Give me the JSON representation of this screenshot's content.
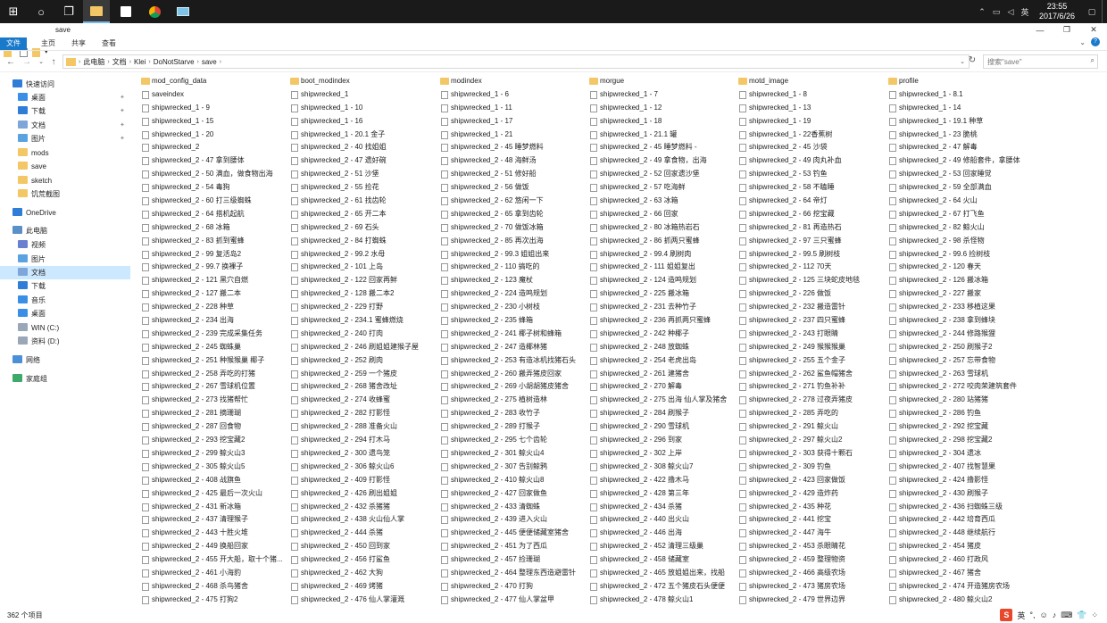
{
  "taskbar": {
    "clock_time": "23:55",
    "clock_date": "2017/6/26",
    "ime": "英"
  },
  "window": {
    "title": "save"
  },
  "ribbon": {
    "tabs": [
      "文件",
      "主页",
      "共享",
      "查看"
    ]
  },
  "address": {
    "crumbs": [
      "此电脑",
      "文档",
      "Klei",
      "DoNotStarve",
      "save"
    ],
    "search_placeholder": "搜索\"save\""
  },
  "nav": [
    {
      "label": "快速访问",
      "icon": "star"
    },
    {
      "label": "桌面",
      "icon": "desktop",
      "pin": true
    },
    {
      "label": "下载",
      "icon": "download",
      "pin": true
    },
    {
      "label": "文档",
      "icon": "document",
      "pin": true
    },
    {
      "label": "图片",
      "icon": "picture",
      "pin": true
    },
    {
      "label": "mods",
      "icon": "folder"
    },
    {
      "label": "save",
      "icon": "folder"
    },
    {
      "label": "sketch",
      "icon": "folder"
    },
    {
      "label": "饥荒截图",
      "icon": "folder"
    },
    {
      "label": "OneDrive",
      "icon": "cloud"
    },
    {
      "label": "此电脑",
      "icon": "computer"
    },
    {
      "label": "视频",
      "icon": "video"
    },
    {
      "label": "图片",
      "icon": "picture"
    },
    {
      "label": "文档",
      "icon": "document",
      "selected": true
    },
    {
      "label": "下载",
      "icon": "download"
    },
    {
      "label": "音乐",
      "icon": "music"
    },
    {
      "label": "桌面",
      "icon": "desktop"
    },
    {
      "label": "WIN (C:)",
      "icon": "drive"
    },
    {
      "label": "资料 (D:)",
      "icon": "drive"
    },
    {
      "label": "网络",
      "icon": "network"
    },
    {
      "label": "家庭组",
      "icon": "homegroup"
    }
  ],
  "files": [
    [
      "mod_config_data",
      "boot_modindex",
      "modindex",
      "morgue",
      "motd_image",
      "profile"
    ],
    [
      "saveindex",
      "shipwrecked_1",
      "shipwrecked_1 - 6",
      "shipwrecked_1 - 7",
      "shipwrecked_1 - 8",
      "shipwrecked_1 - 8.1"
    ],
    [
      "shipwrecked_1 - 9",
      "shipwrecked_1 - 10",
      "shipwrecked_1 - 11",
      "shipwrecked_1 - 12",
      "shipwrecked_1 - 13",
      "shipwrecked_1 - 14"
    ],
    [
      "shipwrecked_1 - 15",
      "shipwrecked_1 - 16",
      "shipwrecked_1 - 17",
      "shipwrecked_1 - 18",
      "shipwrecked_1 - 19",
      "shipwrecked_1 - 19.1 种草"
    ],
    [
      "shipwrecked_1 - 20",
      "shipwrecked_1 - 20.1 金子",
      "shipwrecked_1 - 21",
      "shipwrecked_1 - 21.1 罐",
      "shipwrecked_1 - 22香蕉树",
      "shipwrecked_1 - 23 脆桃"
    ],
    [
      "shipwrecked_2",
      "shipwrecked_2 - 40 找姐姐",
      "shipwrecked_2 - 45 睡梦燃料",
      "shipwrecked_2 - 45 睡梦燃料 -",
      "shipwrecked_2 - 45 沙袋",
      "shipwrecked_2 - 47 解毒"
    ],
    [
      "shipwrecked_2 - 47 拿到腰体",
      "shipwrecked_2 - 47 遗好碗",
      "shipwrecked_2 - 48 海鲜汤",
      "shipwrecked_2 - 49 拿食物，出海",
      "shipwrecked_2 - 49 肉丸补血",
      "shipwrecked_2 - 49 修船套件，拿腰体"
    ],
    [
      "shipwrecked_2 - 50 满血，做食物出海",
      "shipwrecked_2 - 51 沙堡",
      "shipwrecked_2 - 51 修好船",
      "shipwrecked_2 - 52 回家遗沙堡",
      "shipwrecked_2 - 53 钓鱼",
      "shipwrecked_2 - 53 回家睡觉"
    ],
    [
      "shipwrecked_2 - 54 毒狗",
      "shipwrecked_2 - 55 捡花",
      "shipwrecked_2 - 56 做饭",
      "shipwrecked_2 - 57 吃海鲜",
      "shipwrecked_2 - 58 不瞌睡",
      "shipwrecked_2 - 59 全部满血"
    ],
    [
      "shipwrecked_2 - 60 打三级蜘蛛",
      "shipwrecked_2 - 61 找齿轮",
      "shipwrecked_2 - 62 悠闲一下",
      "shipwrecked_2 - 63 冰箱",
      "shipwrecked_2 - 64 帝灯",
      "shipwrecked_2 - 64 火山"
    ],
    [
      "shipwrecked_2 - 64 搭机起航",
      "shipwrecked_2 - 65 开二本",
      "shipwrecked_2 - 65 拿到齿轮",
      "shipwrecked_2 - 66 回家",
      "shipwrecked_2 - 66 挖宝藏",
      "shipwrecked_2 - 67 打飞鱼"
    ],
    [
      "shipwrecked_2 - 68 冰箱",
      "shipwrecked_2 - 69 石头",
      "shipwrecked_2 - 70 做饭冰箱",
      "shipwrecked_2 - 80 冰箱热岩石",
      "shipwrecked_2 - 81 再造热石",
      "shipwrecked_2 - 82 鲸火山"
    ],
    [
      "shipwrecked_2 - 83 抓到蜜蜂",
      "shipwrecked_2 - 84 打蜘蛛",
      "shipwrecked_2 - 85 再次出海",
      "shipwrecked_2 - 86 抓两只蜜蜂",
      "shipwrecked_2 - 97 三只蜜蜂",
      "shipwrecked_2 - 98 杀怪物"
    ],
    [
      "shipwrecked_2 - 99 复活岛2",
      "shipwrecked_2 - 99.2 水母",
      "shipwrecked_2 - 99.3 姐姐出来",
      "shipwrecked_2 - 99.4 刷树肉",
      "shipwrecked_2 - 99.5 刷树枝",
      "shipwrecked_2 - 99.6 捡树枝"
    ],
    [
      "shipwrecked_2 - 99.7 换裸子",
      "shipwrecked_2 - 101 上岛",
      "shipwrecked_2 - 110 搞吃的",
      "shipwrecked_2 - 111 姐姐复出",
      "shipwrecked_2 - 112 70天",
      "shipwrecked_2 - 120 春天"
    ],
    [
      "shipwrecked_2 - 121 黑穴自燃",
      "shipwrecked_2 - 122 回家再鲜",
      "shipwrecked_2 - 123 魔杖",
      "shipwrecked_2 - 124 造鸣规划",
      "shipwrecked_2 - 125 三块蛇皮地毯",
      "shipwrecked_2 - 126 搬冰箱"
    ],
    [
      "shipwrecked_2 - 127 搬二本",
      "shipwrecked_2 - 128 搬二本2",
      "shipwrecked_2 - 224 造鸣规划",
      "shipwrecked_2 - 225 搬冰箱",
      "shipwrecked_2 - 226 做饭",
      "shipwrecked_2 - 227 搬家"
    ],
    [
      "shipwrecked_2 - 228 种草",
      "shipwrecked_2 - 229 打野",
      "shipwrecked_2 - 230 小树枝",
      "shipwrecked_2 - 231 去种竹子",
      "shipwrecked_2 - 232 搬造雷针",
      "shipwrecked_2 - 233 移植这果"
    ],
    [
      "shipwrecked_2 - 234 出海",
      "shipwrecked_2 - 234.1 蜜蜂燃烧",
      "shipwrecked_2 - 235 蜂箱",
      "shipwrecked_2 - 236 再抓两只蜜蜂",
      "shipwrecked_2 - 237 四只蜜蜂",
      "shipwrecked_2 - 238 拿到蜂块"
    ],
    [
      "shipwrecked_2 - 239 完成采集任务",
      "shipwrecked_2 - 240 打肉",
      "shipwrecked_2 - 241 椰子树和蜂箱",
      "shipwrecked_2 - 242 种椰子",
      "shipwrecked_2 - 243 打眼睛",
      "shipwrecked_2 - 244 修路猴狸"
    ],
    [
      "shipwrecked_2 - 245 蜘蛛巢",
      "shipwrecked_2 - 246 刷姐姐建猴子屋",
      "shipwrecked_2 - 247 造椰林猪",
      "shipwrecked_2 - 248 放蜘蛛",
      "shipwrecked_2 - 249 猴猴猴巢",
      "shipwrecked_2 - 250 刷猴子2"
    ],
    [
      "shipwrecked_2 - 251 种猴猴巢 椰子",
      "shipwrecked_2 - 252 刷肉",
      "shipwrecked_2 - 253 有造冰机找猪石头",
      "shipwrecked_2 - 254 老虎出岛",
      "shipwrecked_2 - 255 五个金子",
      "shipwrecked_2 - 257 忘带食物"
    ],
    [
      "shipwrecked_2 - 258 弄吃的打猪",
      "shipwrecked_2 - 259 一个猪皮",
      "shipwrecked_2 - 260 搬弄猪皮回家",
      "shipwrecked_2 - 261 建猪舍",
      "shipwrecked_2 - 262 鲨鱼帽猪舍",
      "shipwrecked_2 - 263 雪球机"
    ],
    [
      "shipwrecked_2 - 267 雪球机位置",
      "shipwrecked_2 - 268 猪舍改址",
      "shipwrecked_2 - 269 小胡胡猪皮猪舍",
      "shipwrecked_2 - 270 解毒",
      "shipwrecked_2 - 271 钓鱼补补",
      "shipwrecked_2 - 272 咬肉荣建筑套件"
    ],
    [
      "shipwrecked_2 - 273 找猪帮忙",
      "shipwrecked_2 - 274 收蜂蜜",
      "shipwrecked_2 - 275 植树造林",
      "shipwrecked_2 - 275 出海 仙人掌及猪舍",
      "shipwrecked_2 - 278 过夜弄猪皮",
      "shipwrecked_2 - 280 站猪猪"
    ],
    [
      "shipwrecked_2 - 281 摘珊瑚",
      "shipwrecked_2 - 282 打影怪",
      "shipwrecked_2 - 283 收竹子",
      "shipwrecked_2 - 284 刷猴子",
      "shipwrecked_2 - 285 弄吃的",
      "shipwrecked_2 - 286 钓鱼"
    ],
    [
      "shipwrecked_2 - 287 回食物",
      "shipwrecked_2 - 288 准备火山",
      "shipwrecked_2 - 289 打猴子",
      "shipwrecked_2 - 290 雪球机",
      "shipwrecked_2 - 291 鲸火山",
      "shipwrecked_2 - 292 挖宝藏"
    ],
    [
      "shipwrecked_2 - 293 挖宝藏2",
      "shipwrecked_2 - 294 打木马",
      "shipwrecked_2 - 295 七个齿轮",
      "shipwrecked_2 - 296 到家",
      "shipwrecked_2 - 297 鲸火山2",
      "shipwrecked_2 - 298 挖宝藏2"
    ],
    [
      "shipwrecked_2 - 299 鲸火山3",
      "shipwrecked_2 - 300 遗鸟笼",
      "shipwrecked_2 - 301 鲸火山4",
      "shipwrecked_2 - 302 上岸",
      "shipwrecked_2 - 303 获得十颗石",
      "shipwrecked_2 - 304 遗冰"
    ],
    [
      "shipwrecked_2 - 305 鲸火山5",
      "shipwrecked_2 - 306 鲸火山6",
      "shipwrecked_2 - 307 告别鲸鸦",
      "shipwrecked_2 - 308 鲸火山7",
      "shipwrecked_2 - 309 钓鱼",
      "shipwrecked_2 - 407 找智慧果"
    ],
    [
      "shipwrecked_2 - 408 战旗鱼",
      "shipwrecked_2 - 409 打影怪",
      "shipwrecked_2 - 410 鲸火山8",
      "shipwrecked_2 - 422 撸木马",
      "shipwrecked_2 - 423 回家做饭",
      "shipwrecked_2 - 424 撸影怪"
    ],
    [
      "shipwrecked_2 - 425 最后一次火山",
      "shipwrecked_2 - 426 刷出姐姐",
      "shipwrecked_2 - 427 回家做鱼",
      "shipwrecked_2 - 428 第三年",
      "shipwrecked_2 - 429 造炸药",
      "shipwrecked_2 - 430 刷猴子"
    ],
    [
      "shipwrecked_2 - 431 新冰箱",
      "shipwrecked_2 - 432 杀猪猪",
      "shipwrecked_2 - 433 清蜘蛛",
      "shipwrecked_2 - 434 杀猪",
      "shipwrecked_2 - 435 种花",
      "shipwrecked_2 - 436 扫蜘蛛三级"
    ],
    [
      "shipwrecked_2 - 437 清理猴子",
      "shipwrecked_2 - 438 火山仙人掌",
      "shipwrecked_2 - 439 进入火山",
      "shipwrecked_2 - 440 出火山",
      "shipwrecked_2 - 441 挖宝",
      "shipwrecked_2 - 442 培育西瓜"
    ],
    [
      "shipwrecked_2 - 443 十胜火堆",
      "shipwrecked_2 - 444 杀猪",
      "shipwrecked_2 - 445 便便储藏室猪舍",
      "shipwrecked_2 - 446 出海",
      "shipwrecked_2 - 447 海牛",
      "shipwrecked_2 - 448 继续航行"
    ],
    [
      "shipwrecked_2 - 449 换船回家",
      "shipwrecked_2 - 450 回到家",
      "shipwrecked_2 - 451 为了西瓜",
      "shipwrecked_2 - 452 清理三级巢",
      "shipwrecked_2 - 453 杀眼睛花",
      "shipwrecked_2 - 454 猪皮"
    ],
    [
      "shipwrecked_2 - 455 开大船，取十个猪...",
      "shipwrecked_2 - 456 打鲨鱼",
      "shipwrecked_2 - 457 捡珊瑚",
      "shipwrecked_2 - 458 储藏室",
      "shipwrecked_2 - 459 整理物资",
      "shipwrecked_2 - 460 打政风"
    ],
    [
      "shipwrecked_2 - 461 小海豹",
      "shipwrecked_2 - 462 大狗",
      "shipwrecked_2 - 464 整理东西造避雷针",
      "shipwrecked_2 - 465 放姐姐出来，找船",
      "shipwrecked_2 - 466 高级农场",
      "shipwrecked_2 - 467 猪舍"
    ],
    [
      "shipwrecked_2 - 468 杀鸟猪舍",
      "shipwrecked_2 - 469 烤猪",
      "shipwrecked_2 - 470 打狗",
      "shipwrecked_2 - 472 五个猪皮石头便便",
      "shipwrecked_2 - 473 猪房农场",
      "shipwrecked_2 - 474 开造猪房农场"
    ],
    [
      "shipwrecked_2 - 475 打狗2",
      "shipwrecked_2 - 476 仙人掌灌溉",
      "shipwrecked_2 - 477 仙人掌盆甲",
      "shipwrecked_2 - 478 鲸火山1",
      "shipwrecked_2 - 479 世界边界",
      "shipwrecked_2 - 480 鲸火山2"
    ]
  ],
  "status": {
    "count": "362 个项目"
  },
  "colors": {
    "accent": "#1979ca",
    "folder": "#f4c766",
    "selection": "#cce8ff"
  }
}
